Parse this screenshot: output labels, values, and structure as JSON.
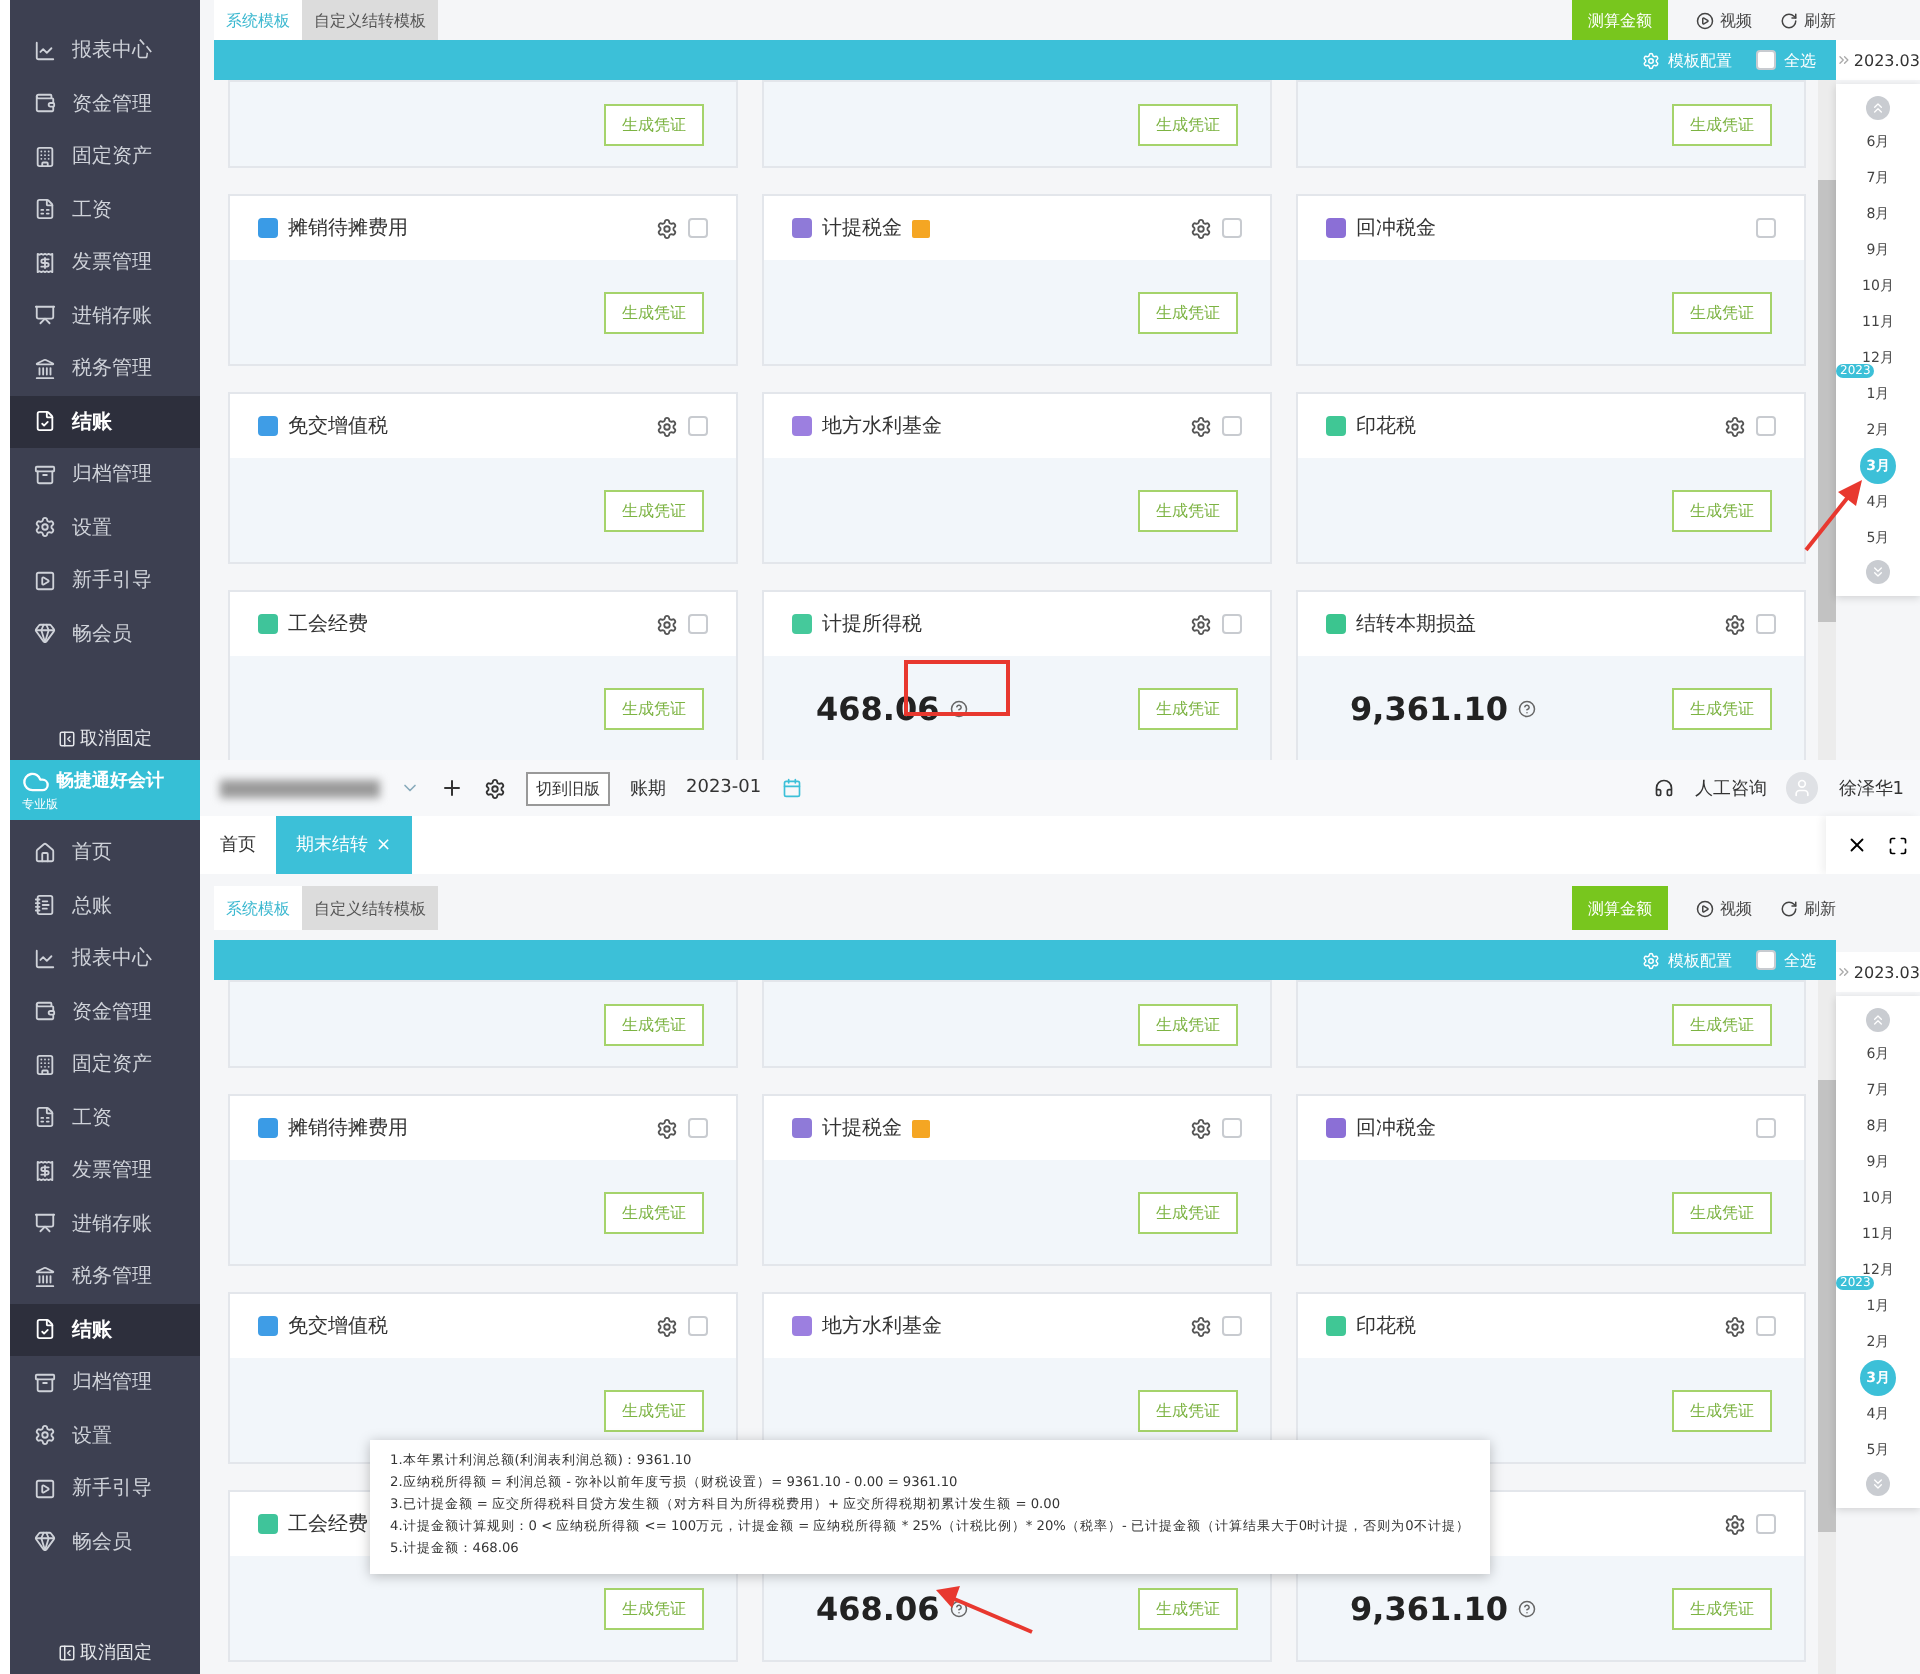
{
  "screens": [
    {
      "sidebar": {
        "items": [
          {
            "label": "报表中心",
            "kind": "reports",
            "selected": false
          },
          {
            "label": "资金管理",
            "kind": "funds",
            "selected": false
          },
          {
            "label": "固定资产",
            "kind": "assets",
            "selected": false
          },
          {
            "label": "工资",
            "kind": "payroll",
            "selected": false
          },
          {
            "label": "发票管理",
            "kind": "invoice",
            "selected": false
          },
          {
            "label": "进销存账",
            "kind": "inventory",
            "selected": false
          },
          {
            "label": "税务管理",
            "kind": "tax",
            "selected": false
          },
          {
            "label": "结账",
            "kind": "closing",
            "selected": true
          },
          {
            "label": "归档管理",
            "kind": "archive",
            "selected": false
          },
          {
            "label": "设置",
            "kind": "settings",
            "selected": false
          },
          {
            "label": "新手引导",
            "kind": "guide",
            "selected": false
          },
          {
            "label": "畅会员",
            "kind": "member",
            "selected": false
          }
        ],
        "unpin": "取消固定"
      },
      "template_tabs": [
        {
          "label": "系统模板",
          "selected": true
        },
        {
          "label": "自定义结转模板",
          "selected": false
        }
      ],
      "actions": {
        "calculate": "测算金额",
        "video": "视频",
        "refresh": "刷新"
      },
      "bar": {
        "config": "模板配置",
        "select_all": "全选",
        "checked": false
      },
      "calendar": {
        "period": "2023.03",
        "months": [
          {
            "label": "6月",
            "selected": false
          },
          {
            "label": "7月",
            "selected": false
          },
          {
            "label": "8月",
            "selected": false
          },
          {
            "label": "9月",
            "selected": false
          },
          {
            "label": "10月",
            "selected": false
          },
          {
            "label": "11月",
            "selected": false
          },
          {
            "label": "12月",
            "selected": false
          },
          {
            "label": "1月",
            "year": "2023",
            "selected": false
          },
          {
            "label": "2月",
            "selected": false
          },
          {
            "label": "3月",
            "selected": true
          },
          {
            "label": "4月",
            "selected": false
          },
          {
            "label": "5月",
            "selected": false
          }
        ]
      },
      "cards": [
        {
          "button": "生成凭证"
        },
        {
          "button": "生成凭证"
        },
        {
          "button": "生成凭证"
        },
        {
          "title": "摊销待摊费用",
          "color": "#3a9be6",
          "settings": true,
          "checked": false,
          "button": "生成凭证"
        },
        {
          "title": "计提税金",
          "color": "#8f7ad8",
          "settings": true,
          "checked": false,
          "flagged": true,
          "button": "生成凭证"
        },
        {
          "title": "回冲税金",
          "color": "#8b6fd6",
          "settings": false,
          "checked": false,
          "button": "生成凭证"
        },
        {
          "title": "免交增值税",
          "color": "#3f9de6",
          "settings": true,
          "checked": false,
          "button": "生成凭证"
        },
        {
          "title": "地方水利基金",
          "color": "#9c7fe0",
          "settings": true,
          "checked": false,
          "button": "生成凭证"
        },
        {
          "title": "印花税",
          "color": "#40c795",
          "settings": true,
          "checked": false,
          "button": "生成凭证"
        },
        {
          "title": "工会经费",
          "color": "#3fc49a",
          "settings": true,
          "checked": false,
          "button": "生成凭证"
        },
        {
          "title": "计提所得税",
          "color": "#45c99b",
          "settings": true,
          "checked": false,
          "value": "468.06",
          "button": "生成凭证"
        },
        {
          "title": "结转本期损益",
          "color": "#3bc58f",
          "settings": true,
          "checked": false,
          "value": "9,361.10",
          "button": "生成凭证"
        }
      ],
      "annotations": [
        {
          "kind": "help-box"
        },
        {
          "kind": "calendar-arrow"
        }
      ]
    },
    {
      "logo": {
        "name": "畅捷通好会计",
        "edition": "专业版"
      },
      "header": {
        "switch": "切到旧版",
        "period_label": "账期",
        "period": "2023-01",
        "support": "人工咨询",
        "user": "徐泽华1"
      },
      "page_tabs": [
        {
          "label": "首页",
          "selected": false
        },
        {
          "label": "期末结转",
          "selected": true,
          "close": "×"
        }
      ],
      "sidebar": {
        "items": [
          {
            "label": "首页",
            "kind": "home",
            "selected": false
          },
          {
            "label": "总账",
            "kind": "ledger",
            "selected": false
          },
          {
            "label": "报表中心",
            "kind": "reports",
            "selected": false
          },
          {
            "label": "资金管理",
            "kind": "funds",
            "selected": false
          },
          {
            "label": "固定资产",
            "kind": "assets",
            "selected": false
          },
          {
            "label": "工资",
            "kind": "payroll",
            "selected": false
          },
          {
            "label": "发票管理",
            "kind": "invoice",
            "selected": false
          },
          {
            "label": "进销存账",
            "kind": "inventory",
            "selected": false
          },
          {
            "label": "税务管理",
            "kind": "tax",
            "selected": false
          },
          {
            "label": "结账",
            "kind": "closing",
            "selected": true
          },
          {
            "label": "归档管理",
            "kind": "archive",
            "selected": false
          },
          {
            "label": "设置",
            "kind": "settings",
            "selected": false
          },
          {
            "label": "新手引导",
            "kind": "guide",
            "selected": false
          },
          {
            "label": "畅会员",
            "kind": "member",
            "selected": false
          }
        ],
        "unpin": "取消固定"
      },
      "template_tabs": [
        {
          "label": "系统模板",
          "selected": true
        },
        {
          "label": "自定义结转模板",
          "selected": false
        }
      ],
      "actions": {
        "calculate": "测算金额",
        "video": "视频",
        "refresh": "刷新"
      },
      "bar": {
        "config": "模板配置",
        "select_all": "全选",
        "checked": false
      },
      "calendar": {
        "period": "2023.03",
        "months": [
          {
            "label": "6月",
            "selected": false
          },
          {
            "label": "7月",
            "selected": false
          },
          {
            "label": "8月",
            "selected": false
          },
          {
            "label": "9月",
            "selected": false
          },
          {
            "label": "10月",
            "selected": false
          },
          {
            "label": "11月",
            "selected": false
          },
          {
            "label": "12月",
            "selected": false
          },
          {
            "label": "1月",
            "year": "2023",
            "selected": false
          },
          {
            "label": "2月",
            "selected": false
          },
          {
            "label": "3月",
            "selected": true
          },
          {
            "label": "4月",
            "selected": false
          },
          {
            "label": "5月",
            "selected": false
          }
        ]
      },
      "cards": [
        {
          "button": "生成凭证"
        },
        {
          "button": "生成凭证"
        },
        {
          "button": "生成凭证"
        },
        {
          "title": "摊销待摊费用",
          "color": "#3a9be6",
          "settings": true,
          "checked": false,
          "button": "生成凭证"
        },
        {
          "title": "计提税金",
          "color": "#8f7ad8",
          "settings": true,
          "checked": false,
          "flagged": true,
          "button": "生成凭证"
        },
        {
          "title": "回冲税金",
          "color": "#8b6fd6",
          "settings": false,
          "checked": false,
          "button": "生成凭证"
        },
        {
          "title": "免交增值税",
          "color": "#3f9de6",
          "settings": true,
          "checked": false,
          "button": "生成凭证"
        },
        {
          "title": "地方水利基金",
          "color": "#9c7fe0",
          "settings": true,
          "checked": false,
          "button": "生成凭证"
        },
        {
          "title": "印花税",
          "color": "#40c795",
          "settings": true,
          "checked": false,
          "button": "生成凭证"
        },
        {
          "title": "工会经费",
          "color": "#3fc49a",
          "button": "生成凭证"
        },
        {
          "value": "468.06",
          "button": "生成凭证"
        },
        {
          "settings": true,
          "checked": false,
          "value": "9,361.10",
          "button": "生成凭证"
        }
      ],
      "tooltip": {
        "lines": [
          "1.本年累计利润总额(利润表利润总额)：9361.10",
          "2.应纳税所得额 = 利润总额 - 弥补以前年度亏损（财税设置）= 9361.10 - 0.00 = 9361.10",
          "3.已计提金额 = 应交所得税科目贷方发生额（对方科目为所得税费用）+ 应交所得税期初累计发生额 = 0.00",
          "4.计提金额计算规则：0 < 应纳税所得额 <= 100万元，计提金额 = 应纳税所得额 * 25%（计税比例）* 20%（税率）- 已计提金额（计算结果大于0时计提，否则为0不计提）",
          "5.计提金额：468.06"
        ]
      },
      "annotations": [
        {
          "kind": "help-arrow"
        }
      ]
    }
  ]
}
